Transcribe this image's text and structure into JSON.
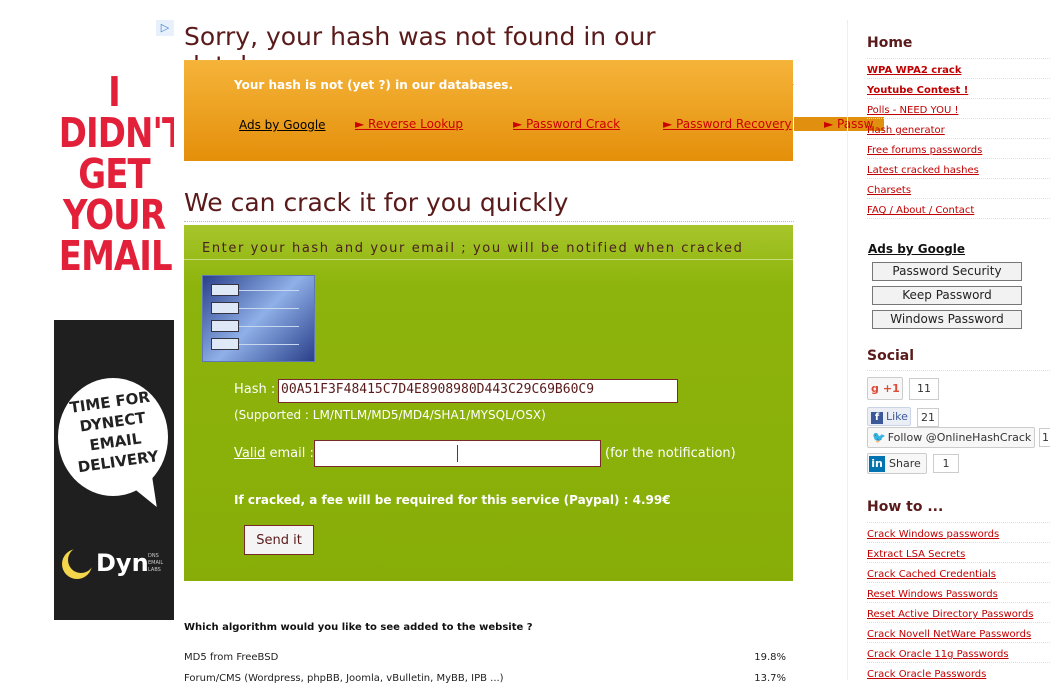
{
  "left_ad": {
    "adchoices_icon": "adchoices-triangle",
    "headline": [
      "I",
      "DIDN'T",
      "GET",
      "YOUR",
      "EMAIL."
    ],
    "bubble_lines": [
      "TIME FOR",
      "DYNECT",
      "EMAIL",
      "DELIVERY"
    ],
    "brand": "Dyn",
    "brand_sub": [
      "DNS",
      "EMAIL",
      "LABS"
    ]
  },
  "main": {
    "title": "Sorry, your hash was not found in our databases.",
    "not_found_msg": "Your hash is not (yet ?) in our databases.",
    "ads_by_google": "Ads by Google",
    "ad_links": [
      "► Reverse Lookup",
      "► Password Crack",
      "► Password Recovery",
      "► Passw"
    ],
    "crack_title": "We can crack it for you quickly",
    "enter_instructions": "Enter your hash and your email ; you will be notified when cracked",
    "hash_label": "Hash :",
    "hash_value": "00A51F3F48415C7D4E8908980D443C29C69B60C9",
    "supported": "(Supported : LM/NTLM/MD5/MD4/SHA1/MYSQL/OSX)",
    "valid_label": "Valid",
    "email_label": " email :",
    "email_value": "",
    "notification_note": "(for the notification)",
    "fee_text": "If cracked, a fee will be required for this service (Paypal) : 4.99€",
    "send_button": "Send it",
    "poll_question": "Which algorithm would you like to see added to the website ?",
    "poll_rows": [
      {
        "label": "MD5 from FreeBSD",
        "pct": "19.8%"
      },
      {
        "label": "Forum/CMS (Wordpress, phpBB, Joomla, vBulletin, MyBB, IPB ...)",
        "pct": "13.7%"
      }
    ]
  },
  "sidebar": {
    "home_heading": "Home",
    "home_links": [
      {
        "label": "WPA WPA2 crack",
        "bold": true
      },
      {
        "label": "Youtube Contest !",
        "bold": true
      },
      {
        "label": "Polls - NEED YOU !",
        "bold": false
      },
      {
        "label": "Hash generator",
        "bold": false
      },
      {
        "label": "Free forums passwords",
        "bold": false
      },
      {
        "label": "Latest cracked hashes",
        "bold": false
      },
      {
        "label": "Charsets",
        "bold": false
      },
      {
        "label": "FAQ / About / Contact",
        "bold": false
      }
    ],
    "ads_by_google": "Ads by Google",
    "ad_buttons": [
      "Password Security",
      "Keep Password",
      "Windows Password"
    ],
    "social_heading": "Social",
    "gplus_label": "+1",
    "gplus_count": "11",
    "fb_label": "Like",
    "fb_count": "21",
    "twitter_label": "Follow @OnlineHashCrack",
    "twitter_count": "1",
    "linkedin_label": "Share",
    "linkedin_count": "1",
    "howto_heading": "How to ...",
    "howto_links": [
      "Crack Windows passwords",
      "Extract LSA Secrets",
      "Crack Cached Credentials",
      "Reset Windows Passwords",
      "Reset Active Directory Passwords",
      "Crack Novell NetWare Passwords",
      "Crack Oracle 11g Passwords",
      "Crack Oracle Passwords"
    ]
  },
  "colors": {
    "orange_box": "#e8990f",
    "green_box": "#8db40c",
    "heading": "#5a1a1a",
    "link_red": "#c00000"
  }
}
